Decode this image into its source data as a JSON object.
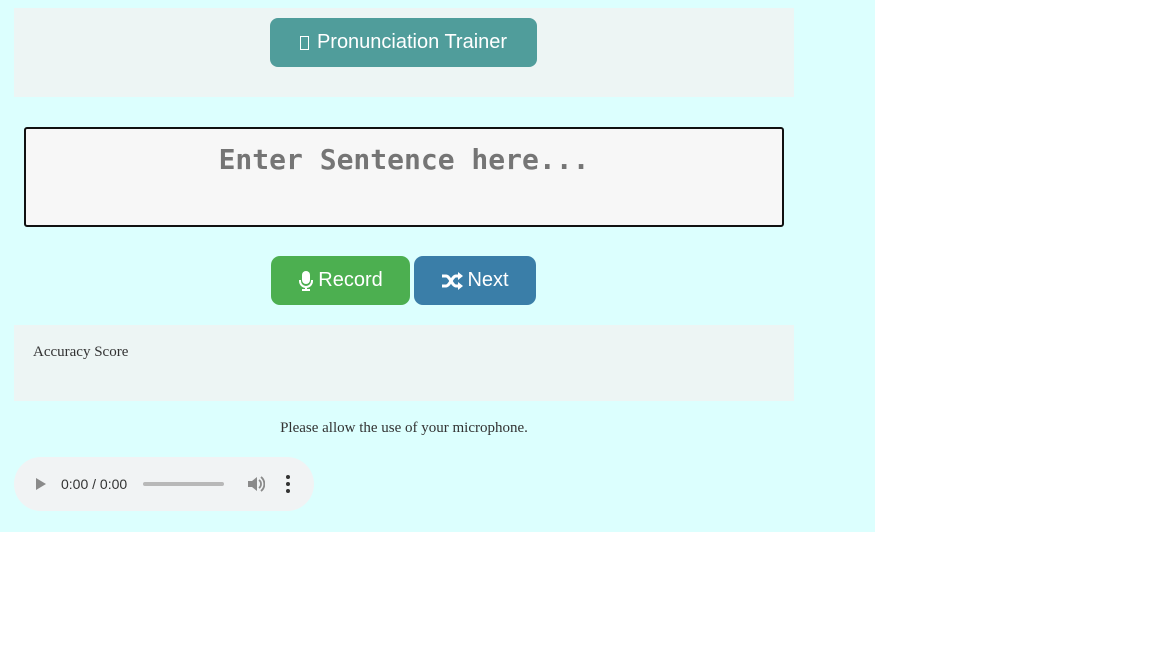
{
  "header": {
    "title": "Pronunciation Trainer",
    "icon": "missing-glyph-icon"
  },
  "sentence": {
    "placeholder": "Enter Sentence here...",
    "value": ""
  },
  "controls": {
    "record_label": "Record",
    "record_icon": "microphone-icon",
    "next_label": "Next",
    "next_icon": "shuffle-icon"
  },
  "accuracy": {
    "label": "Accuracy Score"
  },
  "status": {
    "message": "Please allow the use of your microphone."
  },
  "audio": {
    "time": "0:00 / 0:00",
    "progress": 0
  },
  "colors": {
    "app_bg": "#dcfffe",
    "panel_bg": "#edf5f4",
    "title_button": "#509d9b",
    "record_button": "#4caf50",
    "next_button": "#3a7ea8"
  }
}
